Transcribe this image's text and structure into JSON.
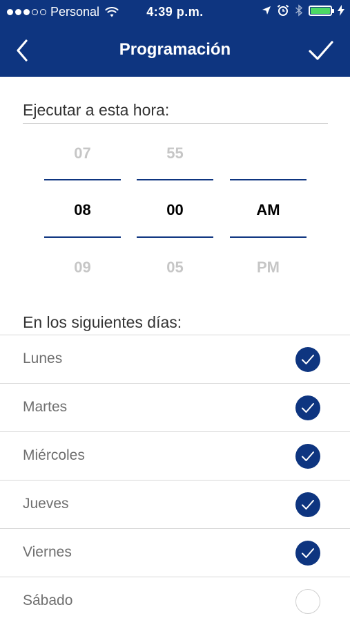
{
  "status_bar": {
    "carrier": "Personal",
    "time": "4:39 p.m.",
    "signal_dots_filled": 3,
    "signal_dots_total": 5,
    "battery_color": "#4cd964"
  },
  "nav": {
    "title": "Programación",
    "back_icon": "chevron-left-icon",
    "done_icon": "checkmark-icon",
    "background": "#0e3580"
  },
  "schedule": {
    "time_label": "Ejecutar a esta hora:",
    "hour": {
      "prev": "07",
      "selected": "08",
      "next": "09"
    },
    "minute": {
      "prev": "55",
      "selected": "00",
      "next": "05"
    },
    "period": {
      "prev": "",
      "selected": "AM",
      "next": "PM"
    }
  },
  "days": {
    "label": "En los siguientes días:",
    "items": [
      {
        "label": "Lunes",
        "checked": true
      },
      {
        "label": "Martes",
        "checked": true
      },
      {
        "label": "Miércoles",
        "checked": true
      },
      {
        "label": "Jueves",
        "checked": true
      },
      {
        "label": "Viernes",
        "checked": true
      },
      {
        "label": "Sábado",
        "checked": false
      }
    ]
  }
}
